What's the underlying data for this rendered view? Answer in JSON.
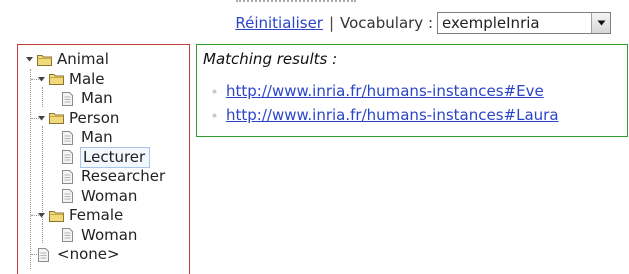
{
  "toolbar": {
    "reset_label": "Réinitialiser",
    "separator": "|",
    "vocabulary_label": "Vocabulary :",
    "vocabulary_selected": "exempleInria"
  },
  "tree": {
    "animal": "Animal",
    "male": "Male",
    "male_man": "Man",
    "person": "Person",
    "person_man": "Man",
    "lecturer": "Lecturer",
    "researcher": "Researcher",
    "person_woman": "Woman",
    "female": "Female",
    "female_woman": "Woman",
    "none": "<none>",
    "selected": "Lecturer"
  },
  "results": {
    "title": "Matching results :",
    "links": [
      "http://www.inria.fr/humans-instances#Eve",
      "http://www.inria.fr/humans-instances#Laura"
    ]
  },
  "colors": {
    "link": "#2b45c8",
    "tree_border": "#c73a3a",
    "results_border": "#2f9a2f",
    "folder": "#e8c24a"
  },
  "icons": {
    "folder": "folder-icon",
    "file": "document-icon",
    "toggle": "collapse-arrow-icon",
    "dropdown": "chevron-down-icon",
    "bullet": "bullet-icon"
  }
}
